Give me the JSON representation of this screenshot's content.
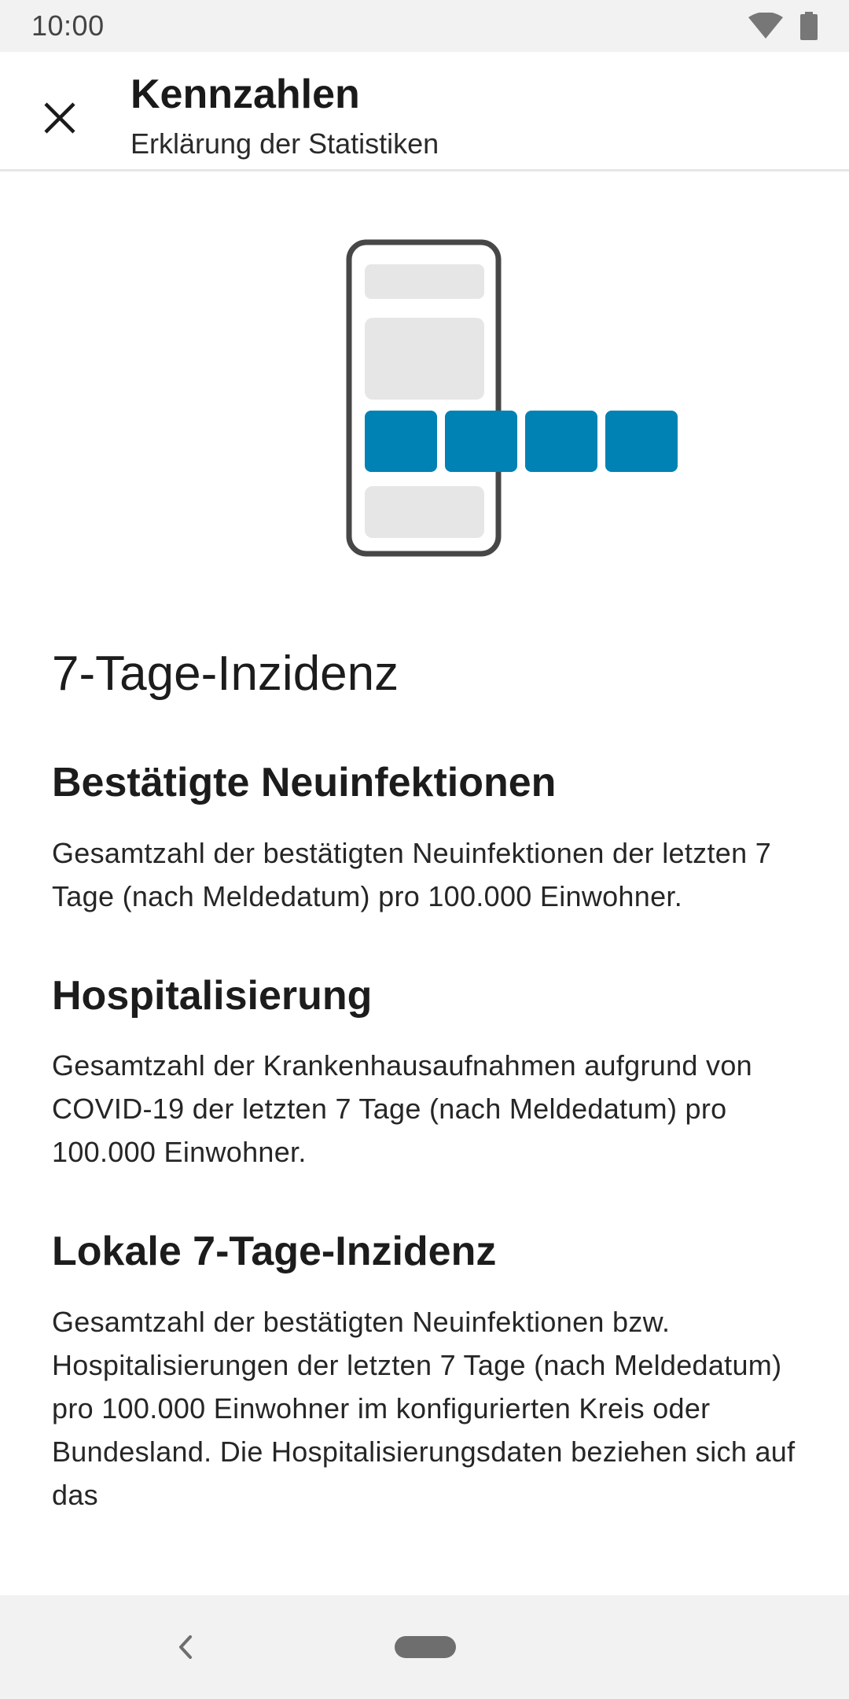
{
  "status_bar": {
    "time": "10:00"
  },
  "app_bar": {
    "title": "Kennzahlen",
    "subtitle": "Erklärung der Statistiken"
  },
  "colors": {
    "accent": "#0082b4",
    "placeholder": "#e6e6e6",
    "phone_frame": "#474747"
  },
  "content": {
    "section_title": "7-Tage-Inzidenz",
    "items": [
      {
        "heading": "Bestätigte Neuinfektionen",
        "text": "Gesamtzahl der bestätigten Neuinfektionen der letzten 7 Tage (nach Meldedatum) pro 100.000 Einwohner."
      },
      {
        "heading": "Hospitalisierung",
        "text": "Gesamtzahl der Krankenhausaufnahmen aufgrund von COVID-19 der letzten 7 Tage (nach Meldedatum) pro 100.000 Einwohner."
      },
      {
        "heading": "Lokale 7-Tage-Inzidenz",
        "text": "Gesamtzahl der bestätigten Neuinfektionen bzw. Hospitalisierungen der letzten 7 Tage (nach Meldedatum) pro 100.000 Einwohner im konfigurierten Kreis oder Bundesland. Die Hospitalisierungsdaten beziehen sich auf das"
      }
    ]
  }
}
